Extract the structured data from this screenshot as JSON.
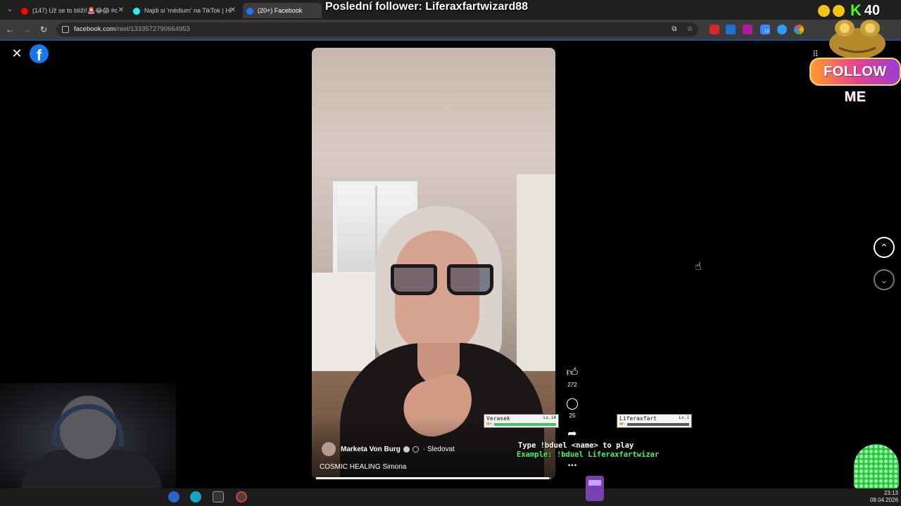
{
  "browser": {
    "tabs": [
      {
        "title": "(147) Už se to blíží!🚨😂😱 #c",
        "color": "#ff0000"
      },
      {
        "title": "Najdi si 'médium' na TikTok | Hl",
        "color": "#25f4ee"
      },
      {
        "title": "(20+) Facebook",
        "color": "#1877f2"
      }
    ],
    "url_host": "facebook.com",
    "url_path": "/reel/1333572790664953",
    "extension_badge": "12"
  },
  "stream_overlay": {
    "last_follower": "Poslední follower: Liferaxfartwizard88",
    "kick_letter": "K",
    "kick_count": "40",
    "follow_me": "FOLLOW ME"
  },
  "reel": {
    "author": "Marketa Von Burg",
    "follow_label": "· Sledovat",
    "caption": "COSMIC HEALING Simona",
    "progress": 0.99,
    "likes": "272",
    "comments": "25",
    "more_label": "..."
  },
  "duel": {
    "player1": {
      "name": "Verasek",
      "level": "Lv.14",
      "hp_label": "HP:",
      "hp": 1.0
    },
    "player2": {
      "name": "Liferaxfart",
      "level": "Lv.1",
      "hp_label": "HP:",
      "hp": 0.0
    },
    "instruction": "Type !bduel <name> to play",
    "example": "Example: !bduel Liferaxfartwizar"
  },
  "taskbar": {
    "time": "23:13",
    "date": "08.04.2026"
  },
  "colors": {
    "facebook_blue": "#1877f2",
    "kick_green": "#53fc18",
    "duel_green": "#4ef06a"
  }
}
